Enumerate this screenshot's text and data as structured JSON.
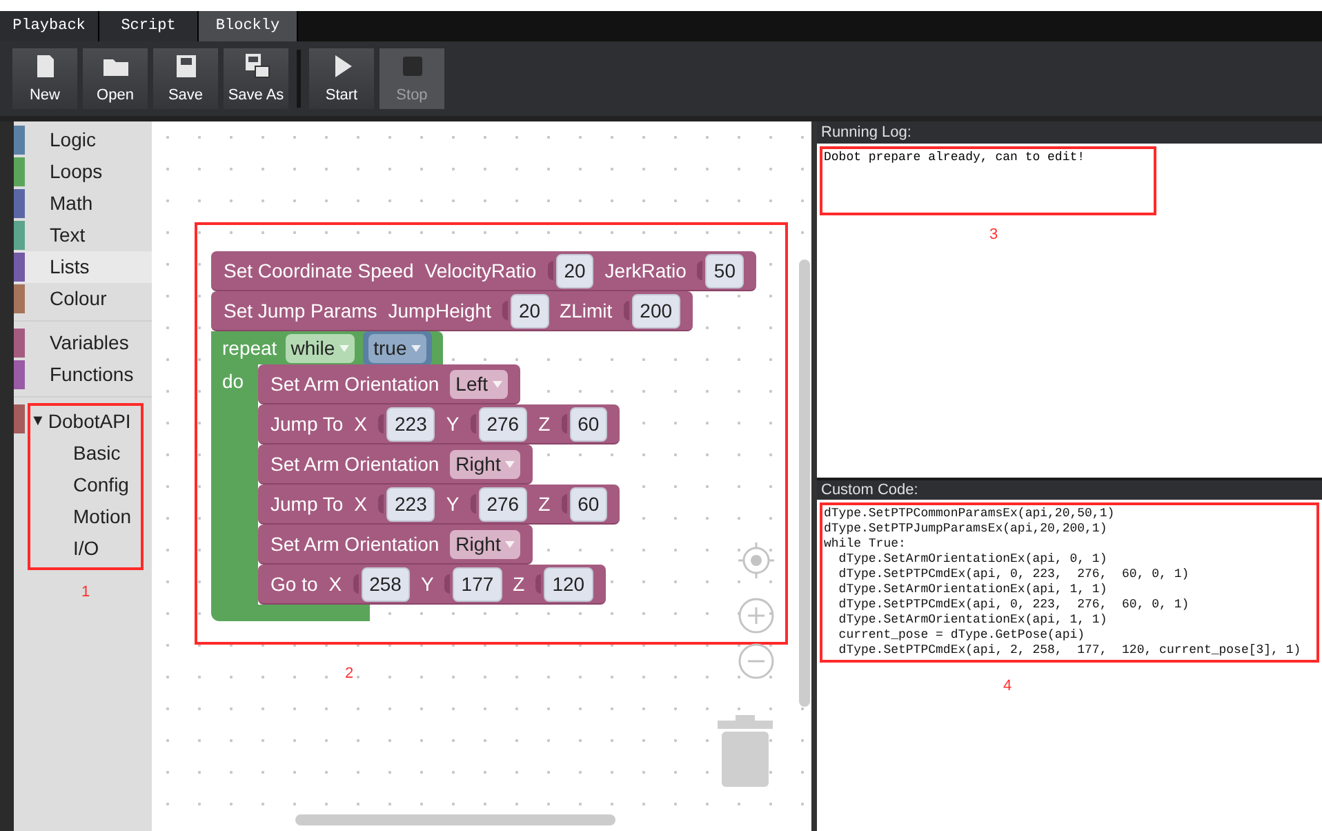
{
  "tabs": [
    {
      "label": "Playback",
      "selected": false
    },
    {
      "label": "Script",
      "selected": false
    },
    {
      "label": "Blockly",
      "selected": true
    }
  ],
  "toolbar": {
    "buttons": [
      {
        "label": "New",
        "disabled": false,
        "separator_before": false
      },
      {
        "label": "Open",
        "disabled": false,
        "separator_before": false
      },
      {
        "label": "Save",
        "disabled": false,
        "separator_before": false
      },
      {
        "label": "Save As",
        "disabled": false,
        "separator_before": false
      },
      {
        "label": "Start",
        "disabled": false,
        "separator_before": true
      },
      {
        "label": "Stop",
        "disabled": true,
        "separator_before": false
      }
    ]
  },
  "toolbox": {
    "groups": [
      {
        "items": [
          {
            "label": "Logic",
            "color": "#5b80a5",
            "selected": false
          },
          {
            "label": "Loops",
            "color": "#5ba55b",
            "selected": false
          },
          {
            "label": "Math",
            "color": "#5b67a5",
            "selected": false
          },
          {
            "label": "Text",
            "color": "#5ba58c",
            "selected": false
          },
          {
            "label": "Lists",
            "color": "#745ba5",
            "selected": true
          },
          {
            "label": "Colour",
            "color": "#a5745b",
            "selected": false
          }
        ]
      },
      {
        "items": [
          {
            "label": "Variables",
            "color": "#a55b80",
            "selected": false
          },
          {
            "label": "Functions",
            "color": "#995ba5",
            "selected": false
          }
        ]
      }
    ],
    "category": {
      "label": "DobotAPI",
      "color": "#a55b5b",
      "expanded": true,
      "toggle": "▼",
      "children": [
        {
          "label": "Basic"
        },
        {
          "label": "Config"
        },
        {
          "label": "Motion"
        },
        {
          "label": "I/O"
        }
      ]
    },
    "annotation": "1"
  },
  "workspace": {
    "annotation": "2",
    "blocks": [
      {
        "kind": "dobot",
        "parts": [
          {
            "kind": "label",
            "text": "Set Coordinate Speed"
          },
          {
            "kind": "label",
            "text": "VelocityRatio"
          },
          {
            "kind": "number",
            "text": "20"
          },
          {
            "kind": "label",
            "text": "JerkRatio"
          },
          {
            "kind": "number",
            "text": "50"
          }
        ]
      },
      {
        "kind": "dobot",
        "parts": [
          {
            "kind": "label",
            "text": "Set Jump Params"
          },
          {
            "kind": "label",
            "text": "JumpHeight"
          },
          {
            "kind": "number",
            "text": "20"
          },
          {
            "kind": "label",
            "text": "ZLimit"
          },
          {
            "kind": "number",
            "text": "200"
          }
        ]
      },
      {
        "kind": "loop",
        "do_label": "do",
        "parts": [
          {
            "kind": "label",
            "text": "repeat"
          },
          {
            "kind": "dropdown",
            "text": "while"
          },
          {
            "kind": "block",
            "parts": [
              {
                "kind": "dropdown",
                "text": "true"
              }
            ]
          }
        ],
        "children": [
          {
            "kind": "dobot",
            "parts": [
              {
                "kind": "label",
                "text": "Set Arm Orientation"
              },
              {
                "kind": "dropdown",
                "text": "Left"
              }
            ]
          },
          {
            "kind": "dobot",
            "parts": [
              {
                "kind": "label",
                "text": "Jump To"
              },
              {
                "kind": "label",
                "text": "X"
              },
              {
                "kind": "number",
                "text": "223"
              },
              {
                "kind": "label",
                "text": "Y"
              },
              {
                "kind": "number",
                "text": "276"
              },
              {
                "kind": "label",
                "text": "Z"
              },
              {
                "kind": "number",
                "text": "60"
              }
            ]
          },
          {
            "kind": "dobot",
            "parts": [
              {
                "kind": "label",
                "text": "Set Arm Orientation"
              },
              {
                "kind": "dropdown",
                "text": "Right"
              }
            ]
          },
          {
            "kind": "dobot",
            "parts": [
              {
                "kind": "label",
                "text": "Jump To"
              },
              {
                "kind": "label",
                "text": "X"
              },
              {
                "kind": "number",
                "text": "223"
              },
              {
                "kind": "label",
                "text": "Y"
              },
              {
                "kind": "number",
                "text": "276"
              },
              {
                "kind": "label",
                "text": "Z"
              },
              {
                "kind": "number",
                "text": "60"
              }
            ]
          },
          {
            "kind": "dobot",
            "parts": [
              {
                "kind": "label",
                "text": "Set Arm Orientation"
              },
              {
                "kind": "dropdown",
                "text": "Right"
              }
            ]
          },
          {
            "kind": "dobot",
            "parts": [
              {
                "kind": "label",
                "text": "Go to"
              },
              {
                "kind": "label",
                "text": "X"
              },
              {
                "kind": "number",
                "text": "258"
              },
              {
                "kind": "label",
                "text": "Y"
              },
              {
                "kind": "number",
                "text": "177"
              },
              {
                "kind": "label",
                "text": "Z"
              },
              {
                "kind": "number",
                "text": "120"
              }
            ]
          }
        ]
      }
    ]
  },
  "running_log": {
    "title": "Running Log:",
    "lines": [
      "Dobot prepare already, can to edit!"
    ],
    "annotation": "3"
  },
  "custom_code": {
    "title": "Custom Code:",
    "lines": [
      "dType.SetPTPCommonParamsEx(api,20,50,1)",
      "dType.SetPTPJumpParamsEx(api,20,200,1)",
      "while True:",
      "  dType.SetArmOrientationEx(api, 0, 1)",
      "  dType.SetPTPCmdEx(api, 0, 223,  276,  60, 0, 1)",
      "  dType.SetArmOrientationEx(api, 1, 1)",
      "  dType.SetPTPCmdEx(api, 0, 223,  276,  60, 0, 1)",
      "  dType.SetArmOrientationEx(api, 1, 1)",
      "  current_pose = dType.GetPose(api)",
      "  dType.SetPTPCmdEx(api, 2, 258,  177,  120, current_pose[3], 1)"
    ],
    "annotation": "4"
  }
}
